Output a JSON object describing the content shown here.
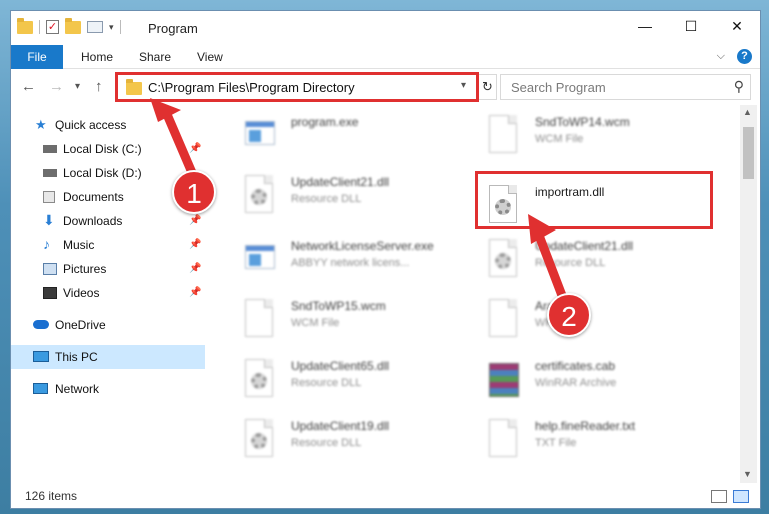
{
  "window": {
    "title": "Program"
  },
  "titlebar": {
    "minimize": "—",
    "maximize": "☐",
    "close": "✕"
  },
  "ribbon": {
    "tabs": [
      "File",
      "Home",
      "Share",
      "View"
    ],
    "expand_icon": "chevron-down-icon",
    "help": "?"
  },
  "address": {
    "path": "C:\\Program Files\\Program Directory",
    "search_placeholder": "Search Program"
  },
  "sidebar": {
    "items": [
      {
        "label": "Quick access",
        "icon": "star-icon"
      },
      {
        "label": "Local Disk (C:)",
        "icon": "drive-icon"
      },
      {
        "label": "Local Disk (D:)",
        "icon": "drive-icon"
      },
      {
        "label": "Documents",
        "icon": "documents-icon"
      },
      {
        "label": "Downloads",
        "icon": "download-icon"
      },
      {
        "label": "Music",
        "icon": "music-icon"
      },
      {
        "label": "Pictures",
        "icon": "pictures-icon"
      },
      {
        "label": "Videos",
        "icon": "videos-icon"
      },
      {
        "label": "OneDrive",
        "icon": "cloud-icon"
      },
      {
        "label": "This PC",
        "icon": "computer-icon"
      },
      {
        "label": "Network",
        "icon": "network-icon"
      }
    ]
  },
  "files": [
    {
      "name": "program.exe",
      "type": "",
      "icon": "exe-icon"
    },
    {
      "name": "SndToWP14.wcm",
      "type": "WCM File",
      "icon": "document-icon"
    },
    {
      "name": "UpdateClient21.dll",
      "type": "Resource DLL",
      "icon": "dll-icon"
    },
    {
      "name": "importram.dll",
      "type": "",
      "icon": "dll-icon"
    },
    {
      "name": "NetworkLicenseServer.exe",
      "type": "ABBYY network licens...",
      "icon": "exe-icon"
    },
    {
      "name": "UpdateClient21.dll",
      "type": "Resource DLL",
      "icon": "dll-icon"
    },
    {
      "name": "SndToWP15.wcm",
      "type": "WCM File",
      "icon": "document-icon"
    },
    {
      "name": "Arabic.dll",
      "type": "WR...",
      "icon": "document-icon"
    },
    {
      "name": "UpdateClient65.dll",
      "type": "Resource DLL",
      "icon": "dll-icon"
    },
    {
      "name": "certificates.cab",
      "type": "WinRAR Archive",
      "icon": "archive-icon"
    },
    {
      "name": "UpdateClient19.dll",
      "type": "Resource DLL",
      "icon": "dll-icon"
    },
    {
      "name": "help.fineReader.txt",
      "type": "TXT File",
      "icon": "document-icon"
    }
  ],
  "annotations": {
    "step1": "1",
    "step2": "2"
  },
  "status": {
    "count": "126 items"
  }
}
